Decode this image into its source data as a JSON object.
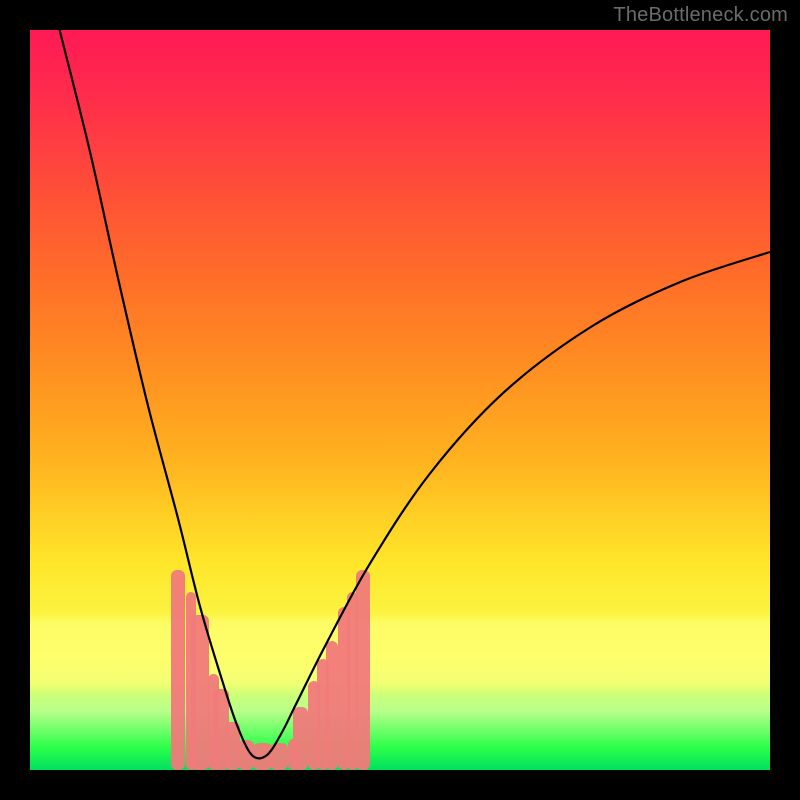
{
  "watermark": "TheBottleneck.com",
  "colors": {
    "bar": "#f07a7a",
    "curve": "#000000"
  },
  "chart_data": {
    "type": "line",
    "title": "",
    "xlabel": "",
    "ylabel": "",
    "xlim": [
      0,
      100
    ],
    "ylim": [
      0,
      100
    ],
    "grid": false,
    "description": "V-shaped bottleneck curve over a vertical spectrum gradient (red=bad at top, green=good at bottom). Minimum (best match) near x≈30. Salmon-colored bars cluster around the valley.",
    "curve_points": [
      {
        "x": 4,
        "y": 100
      },
      {
        "x": 8,
        "y": 84
      },
      {
        "x": 12,
        "y": 66
      },
      {
        "x": 16,
        "y": 49
      },
      {
        "x": 20,
        "y": 34
      },
      {
        "x": 23,
        "y": 22
      },
      {
        "x": 26,
        "y": 12
      },
      {
        "x": 28,
        "y": 6
      },
      {
        "x": 30,
        "y": 2
      },
      {
        "x": 32,
        "y": 2
      },
      {
        "x": 34,
        "y": 5
      },
      {
        "x": 36,
        "y": 9
      },
      {
        "x": 40,
        "y": 17
      },
      {
        "x": 46,
        "y": 28
      },
      {
        "x": 54,
        "y": 40
      },
      {
        "x": 64,
        "y": 51
      },
      {
        "x": 76,
        "y": 60
      },
      {
        "x": 88,
        "y": 66
      },
      {
        "x": 100,
        "y": 70
      }
    ],
    "bars": {
      "note": "x = position along horizontal axis (0-100), h = bar height as % of plot height, w = bar width as % of plot width",
      "items": [
        {
          "x": 20.0,
          "h": 27.0,
          "w": 1.8
        },
        {
          "x": 21.8,
          "h": 24.0,
          "w": 1.4
        },
        {
          "x": 23.0,
          "h": 21.0,
          "w": 2.4
        },
        {
          "x": 24.8,
          "h": 13.0,
          "w": 1.4
        },
        {
          "x": 25.8,
          "h": 11.0,
          "w": 2.2
        },
        {
          "x": 27.4,
          "h": 6.5,
          "w": 2.0
        },
        {
          "x": 29.2,
          "h": 4.0,
          "w": 2.2
        },
        {
          "x": 31.4,
          "h": 3.7,
          "w": 2.6
        },
        {
          "x": 33.6,
          "h": 3.7,
          "w": 2.4
        },
        {
          "x": 35.6,
          "h": 4.2,
          "w": 1.6
        },
        {
          "x": 36.6,
          "h": 8.5,
          "w": 2.0
        },
        {
          "x": 38.4,
          "h": 12.0,
          "w": 1.6
        },
        {
          "x": 39.6,
          "h": 15.0,
          "w": 1.6
        },
        {
          "x": 40.8,
          "h": 17.5,
          "w": 1.6
        },
        {
          "x": 42.4,
          "h": 22.0,
          "w": 1.6
        },
        {
          "x": 43.6,
          "h": 24.0,
          "w": 1.4
        },
        {
          "x": 45.0,
          "h": 27.0,
          "w": 1.8
        }
      ]
    }
  }
}
